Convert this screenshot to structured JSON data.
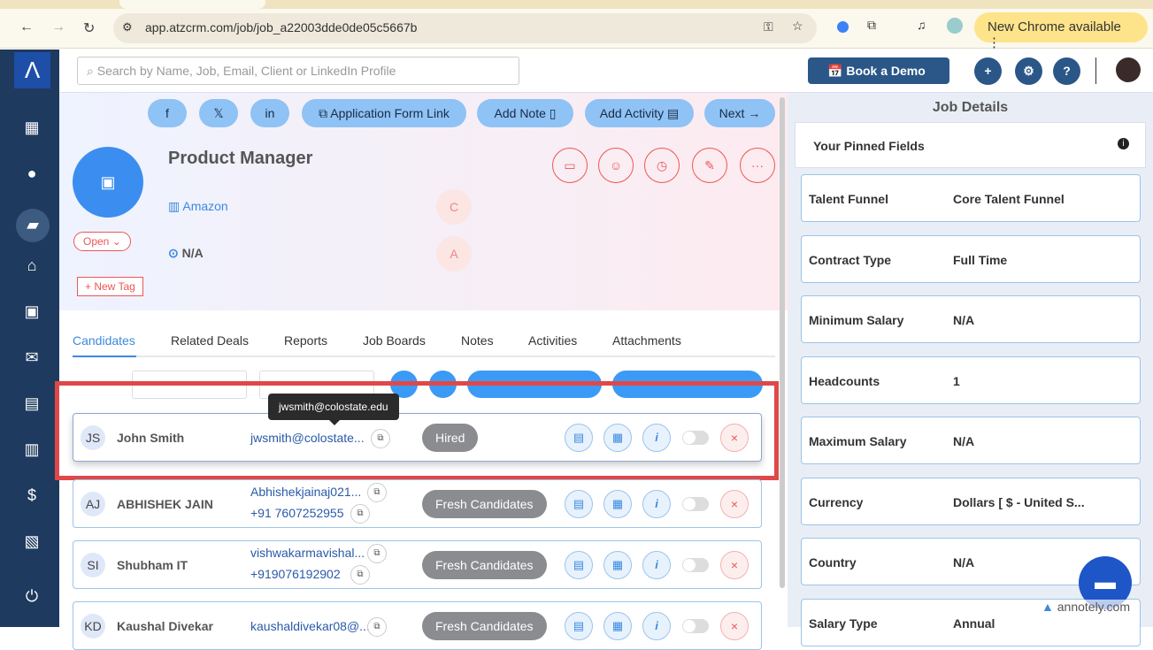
{
  "browser": {
    "url": "app.atzcrm.com/job/job_a22003dde0de05c5667b",
    "update_label": "New Chrome available"
  },
  "header": {
    "search_placeholder": "Search by Name, Job, Email, Client or LinkedIn Profile",
    "demo_label": "Book a Demo"
  },
  "actions": {
    "app_form": "Application Form Link",
    "add_note": "Add Note",
    "add_activity": "Add Activity",
    "next": "Next"
  },
  "job": {
    "title": "Product Manager",
    "company": "Amazon",
    "location": "N/A",
    "status": "Open",
    "new_tag": "+ New Tag",
    "badge1": "C",
    "badge2": "A"
  },
  "tabs": [
    "Candidates",
    "Related Deals",
    "Reports",
    "Job Boards",
    "Notes",
    "Activities",
    "Attachments"
  ],
  "tooltip": "jwsmith@colostate.edu",
  "candidates": [
    {
      "initials": "JS",
      "name": "John Smith",
      "email": "jwsmith@colostate...",
      "phone": "",
      "stage": "Hired"
    },
    {
      "initials": "AJ",
      "name": "ABHISHEK JAIN",
      "email": "Abhishekjainaj021...",
      "phone": "+91 7607252955",
      "stage": "Fresh Candidates"
    },
    {
      "initials": "SI",
      "name": "Shubham IT",
      "email": "vishwakarmavishal...",
      "phone": "+919076192902",
      "stage": "Fresh Candidates"
    },
    {
      "initials": "KD",
      "name": "Kaushal Divekar",
      "email": "kaushaldivekar08@...",
      "phone": "",
      "stage": "Fresh Candidates"
    }
  ],
  "job_details": {
    "title": "Job Details",
    "pinned": "Your Pinned Fields",
    "fields": [
      {
        "k": "Talent Funnel",
        "v": "Core Talent Funnel"
      },
      {
        "k": "Contract Type",
        "v": "Full Time"
      },
      {
        "k": "Minimum Salary",
        "v": "N/A"
      },
      {
        "k": "Headcounts",
        "v": "1"
      },
      {
        "k": "Maximum Salary",
        "v": "N/A"
      },
      {
        "k": "Currency",
        "v": "Dollars [ $ - United S..."
      },
      {
        "k": "Country",
        "v": "N/A"
      },
      {
        "k": "Salary Type",
        "v": "Annual"
      }
    ]
  },
  "watermark": "annotely.com"
}
